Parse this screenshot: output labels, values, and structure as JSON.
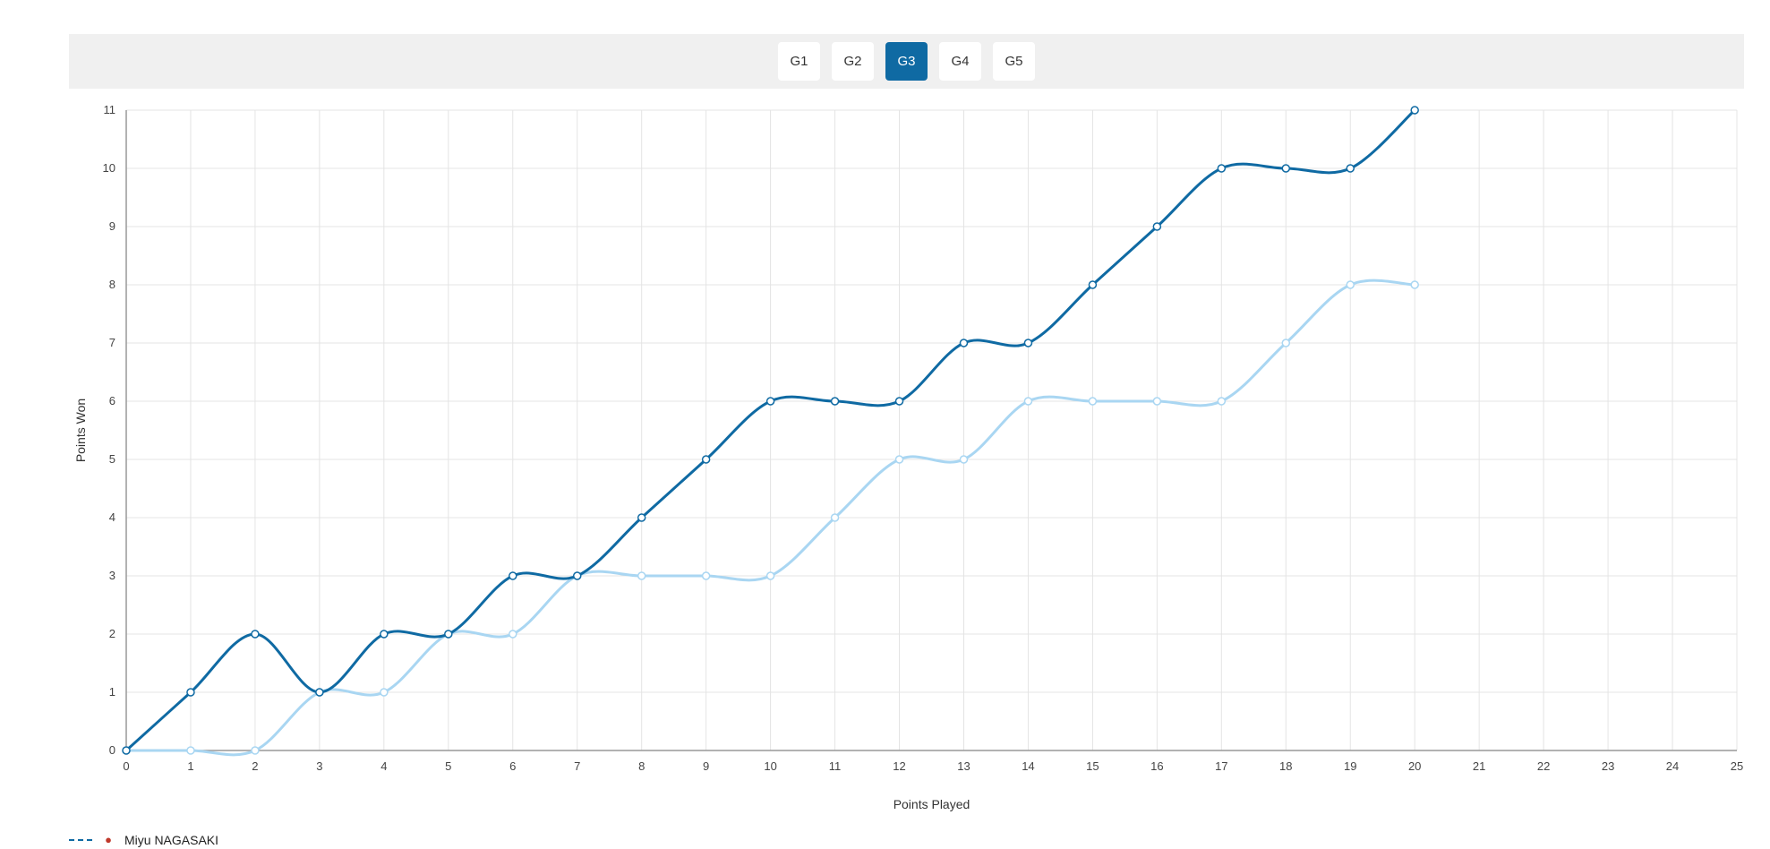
{
  "tabs": [
    {
      "label": "G1",
      "active": false
    },
    {
      "label": "G2",
      "active": false
    },
    {
      "label": "G3",
      "active": true
    },
    {
      "label": "G4",
      "active": false
    },
    {
      "label": "G5",
      "active": false
    }
  ],
  "legend": {
    "name": "Miyu NAGASAKI",
    "icon": "player-avatar-icon"
  },
  "colors": {
    "dark_series": "#0f6aa3",
    "light_series": "#a9d6f2",
    "grid": "#e4e4e4",
    "axis": "#999999"
  },
  "chart_data": {
    "type": "line",
    "xlabel": "Points Played",
    "ylabel": "Points Won",
    "xlim": [
      0,
      25
    ],
    "ylim": [
      0,
      11
    ],
    "grid": true,
    "x": [
      0,
      1,
      2,
      3,
      4,
      5,
      6,
      7,
      8,
      9,
      10,
      11,
      12,
      13,
      14,
      15,
      16,
      17,
      18,
      19,
      20
    ],
    "series": [
      {
        "values": [
          0,
          1,
          2,
          1,
          2,
          2,
          3,
          3,
          4,
          5,
          6,
          6,
          6,
          7,
          7,
          8,
          9,
          10,
          10,
          10,
          11
        ]
      },
      {
        "values": [
          0,
          0,
          0,
          1,
          1,
          2,
          2,
          3,
          3,
          3,
          3,
          4,
          5,
          5,
          6,
          6,
          6,
          6,
          7,
          8,
          8
        ]
      }
    ]
  }
}
